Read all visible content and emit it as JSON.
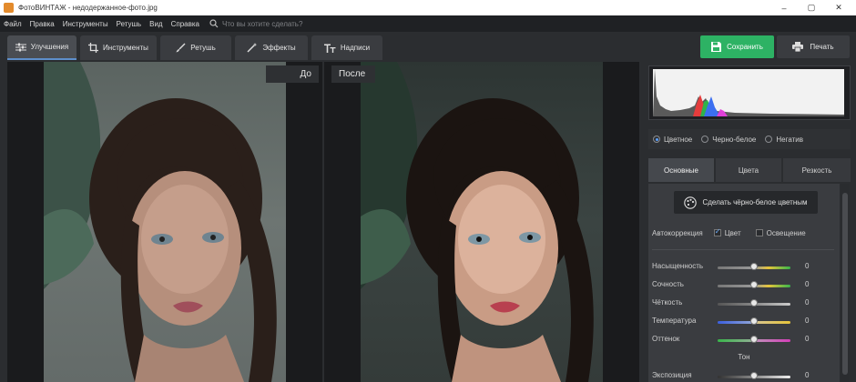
{
  "window": {
    "title": "ФотоВИНТАЖ - недодержанное-фото.jpg",
    "minimize": "–",
    "maximize": "▢",
    "close": "✕"
  },
  "menu": {
    "items": [
      "Файл",
      "Правка",
      "Инструменты",
      "Ретушь",
      "Вид",
      "Справка"
    ],
    "search_placeholder": "Что вы хотите сделать?"
  },
  "toolbar": {
    "tabs": [
      {
        "label": "Улучшения",
        "icon": "sliders-icon",
        "active": true
      },
      {
        "label": "Инструменты",
        "icon": "crop-icon",
        "active": false
      },
      {
        "label": "Ретушь",
        "icon": "brush-icon",
        "active": false
      },
      {
        "label": "Эффекты",
        "icon": "magic-wand-icon",
        "active": false
      },
      {
        "label": "Надписи",
        "icon": "text-icon",
        "active": false
      }
    ],
    "save_label": "Сохранить",
    "print_label": "Печать"
  },
  "preview": {
    "before_label": "До",
    "after_label": "После"
  },
  "panel": {
    "modes": [
      {
        "label": "Цветное",
        "selected": true
      },
      {
        "label": "Черно-белое",
        "selected": false
      },
      {
        "label": "Негатив",
        "selected": false
      }
    ],
    "subtabs": [
      {
        "label": "Основные",
        "active": true
      },
      {
        "label": "Цвета",
        "active": false
      },
      {
        "label": "Резкость",
        "active": false
      }
    ],
    "bw_button": "Сделать чёрно-белое цветным",
    "autocorrection": {
      "label": "Автокоррекция",
      "color_label": "Цвет",
      "color_checked": true,
      "light_label": "Освещение",
      "light_checked": false
    },
    "sliders": [
      {
        "name": "Насыщенность",
        "value": "0",
        "level": 0.5
      },
      {
        "name": "Сочность",
        "value": "0",
        "level": 0.5
      },
      {
        "name": "Чёткость",
        "value": "0",
        "level": 0.5
      },
      {
        "name": "Температура",
        "value": "0",
        "level": 0.5
      },
      {
        "name": "Оттенок",
        "value": "0",
        "level": 0.5
      }
    ],
    "tone_title": "Тон",
    "tone_sliders": [
      {
        "name": "Экспозиция",
        "value": "0",
        "level": 0.5
      }
    ]
  },
  "colors": {
    "accent_green": "#2db264",
    "active_tab_underline": "#5e8fcb"
  }
}
